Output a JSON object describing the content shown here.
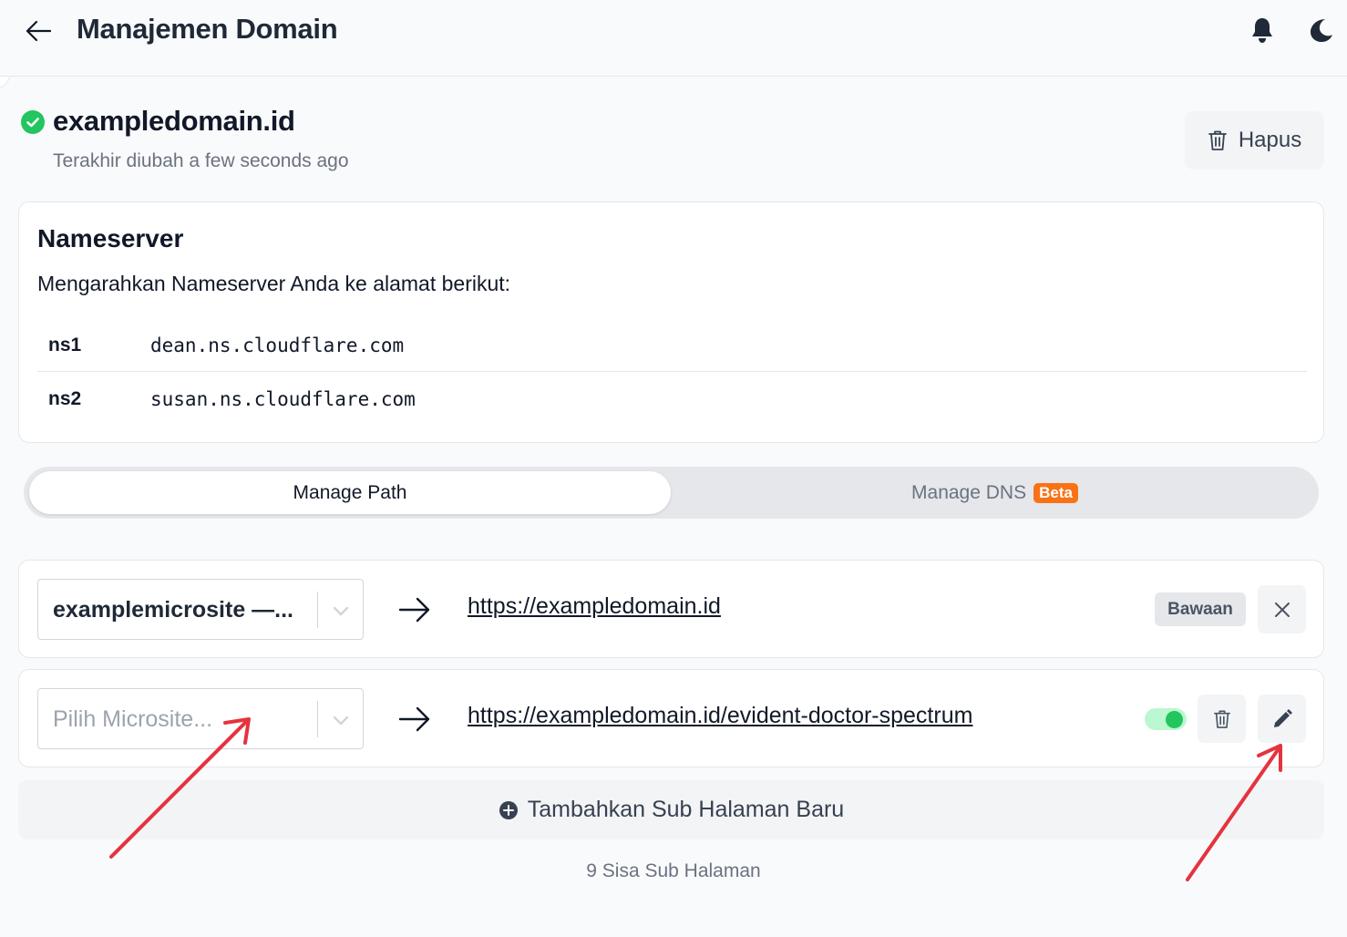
{
  "header": {
    "title": "Manajemen Domain"
  },
  "domain": {
    "name": "exampledomain.id",
    "last_changed": "Terakhir diubah a few seconds ago",
    "delete_label": "Hapus",
    "status_color": "#22c55e"
  },
  "nameserver": {
    "title": "Nameserver",
    "description": "Mengarahkan Nameserver Anda ke alamat berikut:",
    "rows": [
      {
        "key": "ns1",
        "value": "dean.ns.cloudflare.com"
      },
      {
        "key": "ns2",
        "value": "susan.ns.cloudflare.com"
      }
    ]
  },
  "tabs": {
    "manage_path": "Manage Path",
    "manage_dns": "Manage DNS",
    "beta_badge": "Beta",
    "active": "manage_path",
    "beta_color": "#f97316"
  },
  "paths": [
    {
      "select_value": "examplemicrosite —...",
      "url": "https://exampledomain.id",
      "badge": "Bawaan"
    },
    {
      "select_placeholder": "Pilih Microsite...",
      "url": "https://exampledomain.id/evident-doctor-spectrum",
      "enabled": true
    }
  ],
  "actions": {
    "add_sub_page": "Tambahkan Sub Halaman Baru",
    "remaining": "9 Sisa Sub Halaman"
  },
  "annotation_color": "#e5333f"
}
